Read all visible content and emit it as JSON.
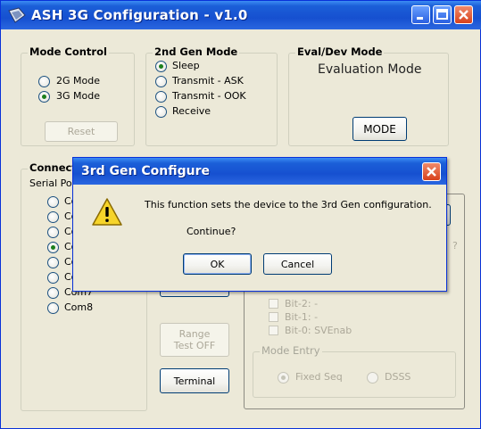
{
  "window": {
    "title": "ASH 3G Configuration - v1.0"
  },
  "mode_control": {
    "label": "Mode Control",
    "options": [
      "2G Mode",
      "3G Mode"
    ],
    "selected": "3G Mode",
    "reset_label": "Reset"
  },
  "gen2_mode": {
    "label": "2nd Gen Mode",
    "options": [
      "Sleep",
      "Transmit - ASK",
      "Transmit - OOK",
      "Receive"
    ],
    "selected": "Sleep"
  },
  "eval_mode": {
    "label": "Eval/Dev Mode",
    "value": "Evaluation Mode",
    "mode_button": "MODE"
  },
  "connection": {
    "label": "Connect",
    "serial_label": "Serial Po",
    "ports": [
      "Co",
      "Co",
      "Co",
      "Co",
      "Co",
      "Co",
      "Com7",
      "Com8"
    ],
    "selected_index": 3
  },
  "buttons": {
    "range_test": "Range Test OFF",
    "terminal": "Terminal"
  },
  "bits": {
    "rows": [
      "Bit-2:  -",
      "Bit-1:  -",
      "Bit-0:  SVEnab"
    ],
    "partial_question": "?"
  },
  "mode_entry": {
    "label": "Mode Entry",
    "options": [
      "Fixed Seq",
      "DSSS"
    ],
    "selected": "Fixed Seq"
  },
  "dialog": {
    "title": "3rd Gen Configure",
    "message": "This function sets the device to the 3rd Gen configuration.",
    "question": "Continue?",
    "ok_label": "OK",
    "cancel_label": "Cancel"
  }
}
